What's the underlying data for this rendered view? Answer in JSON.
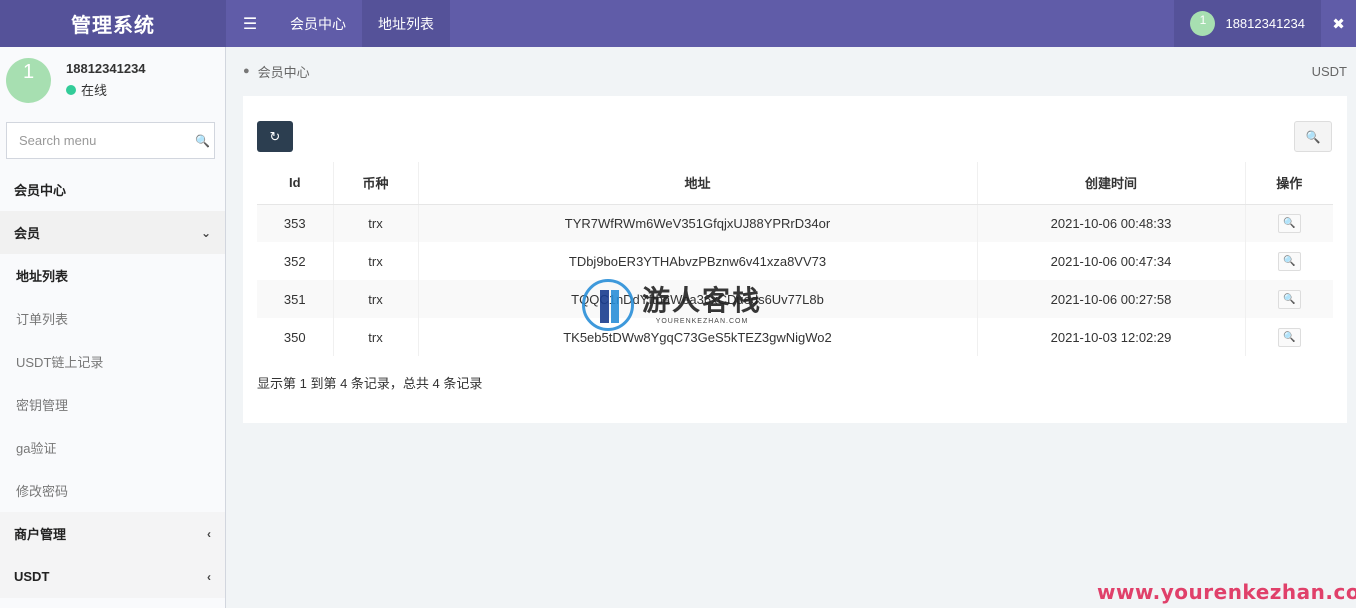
{
  "app": {
    "title": "管理系统"
  },
  "topbar": {
    "tabs": [
      {
        "label": "会员中心"
      },
      {
        "label": "地址列表"
      }
    ],
    "user": {
      "avatar": "1",
      "name": "18812341234"
    }
  },
  "sidebar": {
    "user": {
      "avatar": "1",
      "name": "18812341234",
      "status": "在线"
    },
    "search": {
      "placeholder": "Search menu"
    },
    "items": [
      {
        "label": "会员中心"
      },
      {
        "label": "会员"
      }
    ],
    "sub_items": [
      {
        "label": "地址列表"
      },
      {
        "label": "订单列表"
      },
      {
        "label": "USDT链上记录"
      },
      {
        "label": "密钥管理"
      },
      {
        "label": "ga验证"
      },
      {
        "label": "修改密码"
      }
    ],
    "groups": [
      {
        "label": "商户管理"
      },
      {
        "label": "USDT"
      }
    ]
  },
  "content": {
    "breadcrumb": "会员中心",
    "breadcrumb_right": "USDT",
    "table": {
      "headers": [
        "Id",
        "币种",
        "地址",
        "创建时间",
        "操作"
      ],
      "rows": [
        {
          "id": "353",
          "coin": "trx",
          "address": "TYR7WfRWm6WeV351GfqjxUJ88YPRrD34or",
          "created": "2021-10-06 00:48:33"
        },
        {
          "id": "352",
          "coin": "trx",
          "address": "TDbj9boER3YTHAbvzPBznw6v41xza8VV73",
          "created": "2021-10-06 00:47:34"
        },
        {
          "id": "351",
          "coin": "trx",
          "address": "TQQC1nDdYftbaWea36xCDueds6Uv77L8b",
          "created": "2021-10-06 00:27:58"
        },
        {
          "id": "350",
          "coin": "trx",
          "address": "TK5eb5tDWw8YgqC73GeS5kTEZ3gwNigWo2",
          "created": "2021-10-03 12:02:29"
        }
      ]
    },
    "pager_info": "显示第 1 到第 4 条记录，总共 4 条记录"
  },
  "watermark": {
    "title": "游人客栈",
    "subtitle": "YOURENKEZHAN.COM",
    "url": "www.yourenkezhan.com"
  }
}
